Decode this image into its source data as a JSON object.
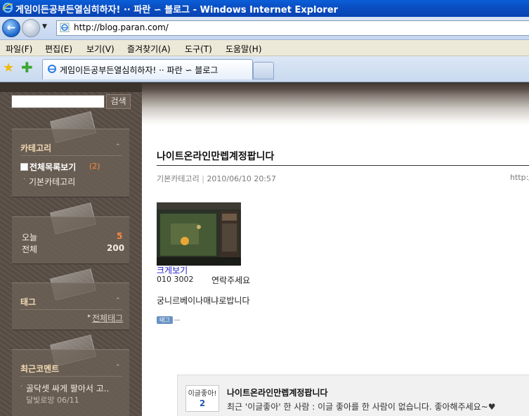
{
  "window": {
    "title": "게임이든공부든열심히하자! ·· 파란 ∽ 블로그 - Windows Internet Explorer",
    "url": "http://blog.paran.com/"
  },
  "menubar": {
    "items": [
      "파일(F)",
      "편집(E)",
      "보기(V)",
      "즐겨찾기(A)",
      "도구(T)",
      "도움말(H)"
    ]
  },
  "tabs": {
    "active_label": "게임이든공부든열심히하자! ·· 파란 ∽ 블로그"
  },
  "sidebar": {
    "search_button": "검색",
    "search_value": "",
    "category": {
      "title": "카테고리",
      "all_label": "전체목록보기",
      "all_count": "(2)",
      "sub_item": "기본카테고리"
    },
    "visitors": {
      "today_label": "오늘",
      "today_value": "5",
      "total_label": "전체",
      "total_value": "200"
    },
    "tags": {
      "title": "태그",
      "all_tags_link": "전체태그"
    },
    "recent_comments": {
      "title": "최근코멘트",
      "items": [
        {
          "text": "골닥셋 싸게 팔아서 고..",
          "meta": "달빛로망 06/11"
        }
      ]
    }
  },
  "post": {
    "title": "나이트온라인만렙계정팝니다",
    "category": "기본카테고리",
    "date": "2010/06/10 20:57",
    "url_prefix": "http:/",
    "view_large": "크게보기",
    "contact_number": "010 3002",
    "contact_label": "연락주세요",
    "body": "궁니르베이나매냐로밥니다",
    "tag_badge": "태그"
  },
  "like_panel": {
    "button_label": "이글좋아!",
    "count": "2",
    "title": "나이트온라인만렙계정팝니다",
    "recent_text": "최근 '이글좋아' 한 사람 : 이글 좋아를 한 사람이 없습니다. 좋아해주세요~♥"
  },
  "colors": {
    "titlebar": "#0a4fc4",
    "sidebar_bg": "#594e45",
    "category_heading": "#f2d9b3",
    "count_orange": "#ff8a3d",
    "like_count": "#2257b5"
  }
}
